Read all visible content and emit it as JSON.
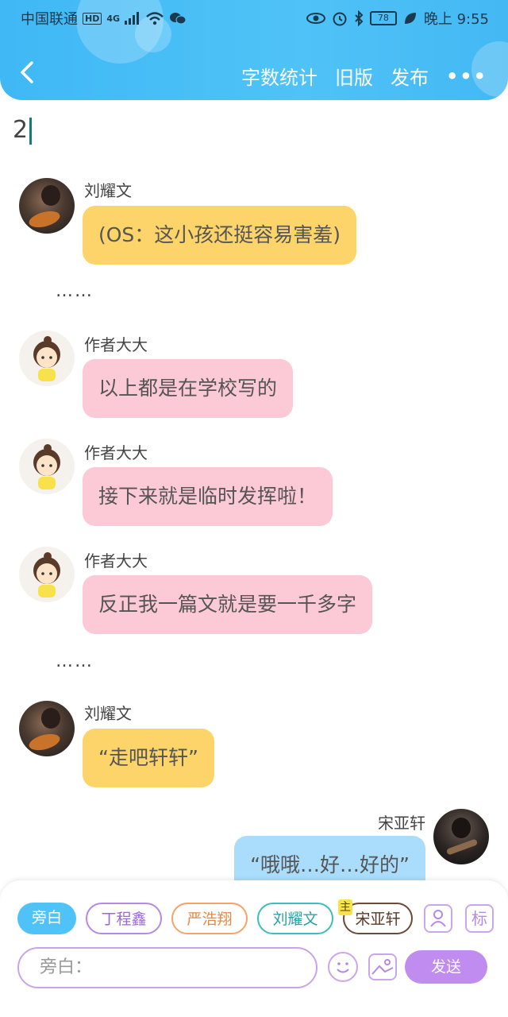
{
  "status_bar": {
    "carrier": "中国联通",
    "hd_tag": "HD",
    "network": "4G",
    "battery": "78",
    "time": "晚上 9:55"
  },
  "nav": {
    "word_count": "字数统计",
    "old_version": "旧版",
    "publish": "发布",
    "more": "•••"
  },
  "editor": {
    "line_text": "2"
  },
  "messages": [
    {
      "author": "刘耀文",
      "text": "(OS：这小孩还挺容易害羞)",
      "color": "yellow"
    },
    {
      "text": "……"
    },
    {
      "author": "作者大大",
      "text": "以上都是在学校写的",
      "color": "pink"
    },
    {
      "author": "作者大大",
      "text": "接下来就是临时发挥啦！",
      "color": "pink"
    },
    {
      "author": "作者大大",
      "text": "反正我一篇文就是要一千多字",
      "color": "pink"
    },
    {
      "text": "……"
    },
    {
      "author": "刘耀文",
      "text": "“走吧轩轩”",
      "color": "yellow"
    },
    {
      "author": "宋亚轩",
      "text": "“哦哦…好…好的”",
      "color": "blue"
    }
  ],
  "role_chips": [
    {
      "label": "旁白"
    },
    {
      "label": "丁程鑫"
    },
    {
      "label": "严浩翔"
    },
    {
      "label": "刘耀文"
    },
    {
      "label": "宋亚轩",
      "badge": "主"
    }
  ],
  "tool_icons": {
    "user_icon": "user-card-icon",
    "tag_icon_label": "标"
  },
  "input": {
    "placeholder": "旁白："
  },
  "send_label": "发送",
  "colors": {
    "header": "#4fc3f7",
    "yellow_bubble": "#fcd46a",
    "pink_bubble": "#fcc9d6",
    "blue_bubble": "#a9ddfb",
    "accent_purple": "#c08cf0"
  }
}
